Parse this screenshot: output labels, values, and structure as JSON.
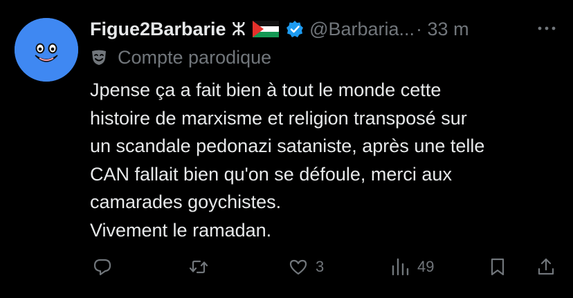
{
  "post": {
    "author": {
      "display_name": "Figue2Barbarie",
      "name_symbol": "ⵣ",
      "flag": "palestine-flag",
      "verified": true,
      "handle": "@Barbaria...",
      "time": "· 33 m"
    },
    "label": {
      "icon": "parody-mask-icon",
      "text": "Compte parodique"
    },
    "text": "Jpense ça a fait bien à tout le monde cette\nhistoire de marxisme et religion transposé sur\nun scandale pedonazi sataniste, après une telle\nCAN fallait bien qu'on se défoule, merci aux\ncamarades goychistes.\nVivement le ramadan.",
    "actions": {
      "reply_icon": "reply-icon",
      "repost_icon": "repost-icon",
      "like_icon": "heart-icon",
      "like_count": "3",
      "views_icon": "views-icon",
      "views_count": "49",
      "bookmark_icon": "bookmark-icon",
      "share_icon": "share-icon"
    }
  },
  "colors": {
    "background": "#000000",
    "text_primary": "#e7e9ea",
    "text_secondary": "#71767b",
    "verified": "#1d9bf0",
    "avatar_bg": "#3f88f2"
  }
}
